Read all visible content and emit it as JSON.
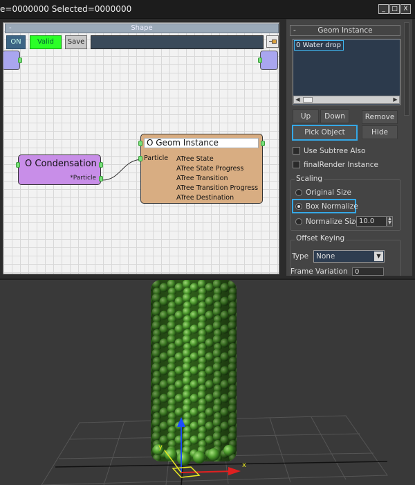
{
  "title_bar": {
    "text": "e=0000000  Selected=0000000",
    "minimize": "_",
    "restore": "□",
    "close": "X"
  },
  "graph": {
    "header_title": "Shape",
    "header_collapse": "-",
    "toolbar": {
      "on_label": "ON",
      "valid_label": "Valid",
      "save_label": "Save",
      "name_value": ""
    },
    "nodes": {
      "condensation": {
        "title": "O Condensation",
        "output": "*Particle"
      },
      "geom_instance": {
        "title": "O Geom Instance",
        "input": "Particle",
        "outputs": [
          "ATree State",
          "ATree State Progress",
          "ATree Transition",
          "ATree Transition Progress",
          "ATree Destination"
        ]
      }
    }
  },
  "panel": {
    "title": "Geom Instance",
    "collapse": "-",
    "list_items": [
      "0 Water drop"
    ],
    "buttons": {
      "up": "Up",
      "down": "Down",
      "remove": "Remove",
      "pick_object": "Pick Object",
      "hide": "Hide"
    },
    "options": {
      "use_subtree": "Use Subtree Also",
      "final_render": "finalRender Instance"
    },
    "scaling": {
      "label": "Scaling",
      "original_size": "Original Size",
      "box_normalize": "Box Normalize",
      "normalize_size": "Normalize Size",
      "normalize_value": "10.0",
      "selected": "Box Normalize"
    },
    "offset_keying": {
      "label": "Offset Keying",
      "type_label": "Type",
      "type_value": "None",
      "frame_variation_label": "Frame Variation",
      "frame_variation_value": "0"
    }
  },
  "viewport": {
    "axis_labels": {
      "x": "x",
      "y": "y"
    }
  },
  "colors": {
    "accent_highlight": "#35a8e6",
    "valid_green": "#2bff28",
    "condensation_node": "#c88ee8",
    "geom_node": "#d8ad82"
  }
}
